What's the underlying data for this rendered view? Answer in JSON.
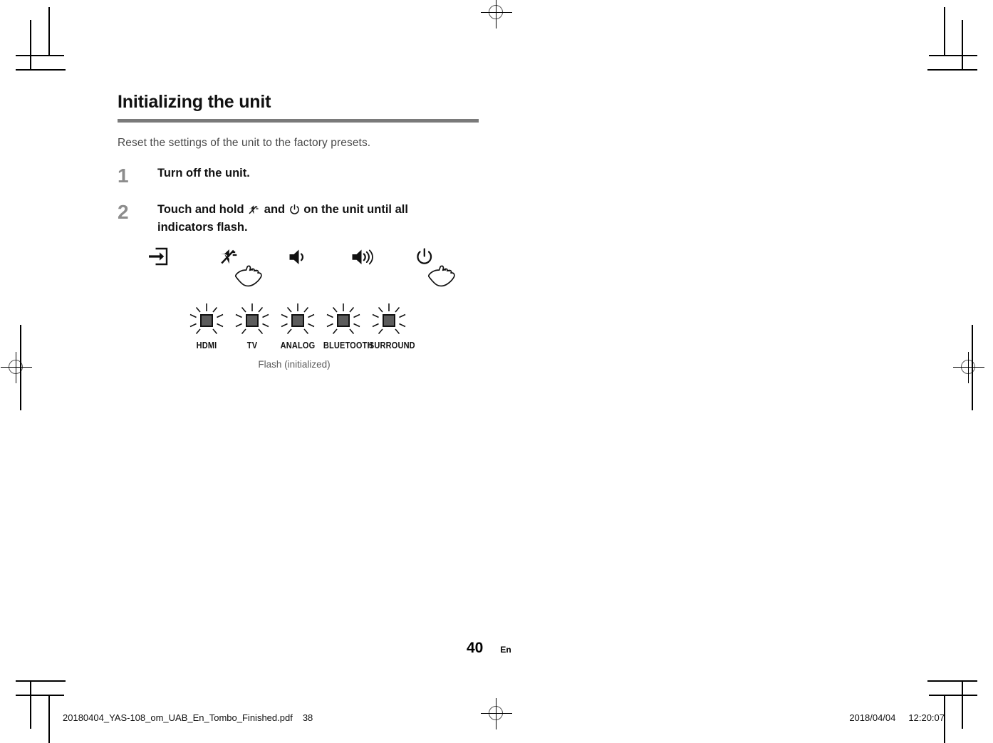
{
  "document": {
    "heading": "Initializing the unit",
    "intro": "Reset the settings of the unit to the factory presets.",
    "steps": [
      {
        "number": "1",
        "text_parts": [
          "Turn off the unit."
        ],
        "text": "Turn off the unit."
      },
      {
        "number": "2",
        "text_before": "Touch and hold ",
        "icon_1": "mute-icon",
        "text_middle": " and ",
        "icon_2": "power-icon",
        "text_after": " on the unit until all indicators flash."
      }
    ]
  },
  "unit_buttons": [
    {
      "name": "input-select-icon",
      "label": "Input select",
      "has_hand": false
    },
    {
      "name": "mute-icon",
      "label": "Mute",
      "has_hand": true
    },
    {
      "name": "volume-down-icon",
      "label": "Volume down",
      "has_hand": false
    },
    {
      "name": "volume-up-icon",
      "label": "Volume up",
      "has_hand": false
    },
    {
      "name": "power-icon",
      "label": "Power",
      "has_hand": true
    }
  ],
  "indicators": {
    "items": [
      {
        "label": "HDMI",
        "state": "flashing"
      },
      {
        "label": "TV",
        "state": "flashing"
      },
      {
        "label": "ANALOG",
        "state": "flashing"
      },
      {
        "label": "BLUETOOTH",
        "state": "flashing"
      },
      {
        "label": "SURROUND",
        "state": "flashing"
      }
    ],
    "caption": "Flash (initialized)"
  },
  "page_footer": {
    "page_number": "40",
    "language": "En"
  },
  "print_footer": {
    "filename": "20180404_YAS-108_om_UAB_En_Tombo_Finished.pdf",
    "sheet_number": "38",
    "date": "2018/04/04",
    "time": "12:20:07"
  },
  "colors": {
    "rule": "#7a7a7a",
    "step_number": "#8d8d8d",
    "indicator_fill": "#5c5c5c",
    "caption": "#5c5c5c",
    "body_text": "#4a4a4a"
  }
}
